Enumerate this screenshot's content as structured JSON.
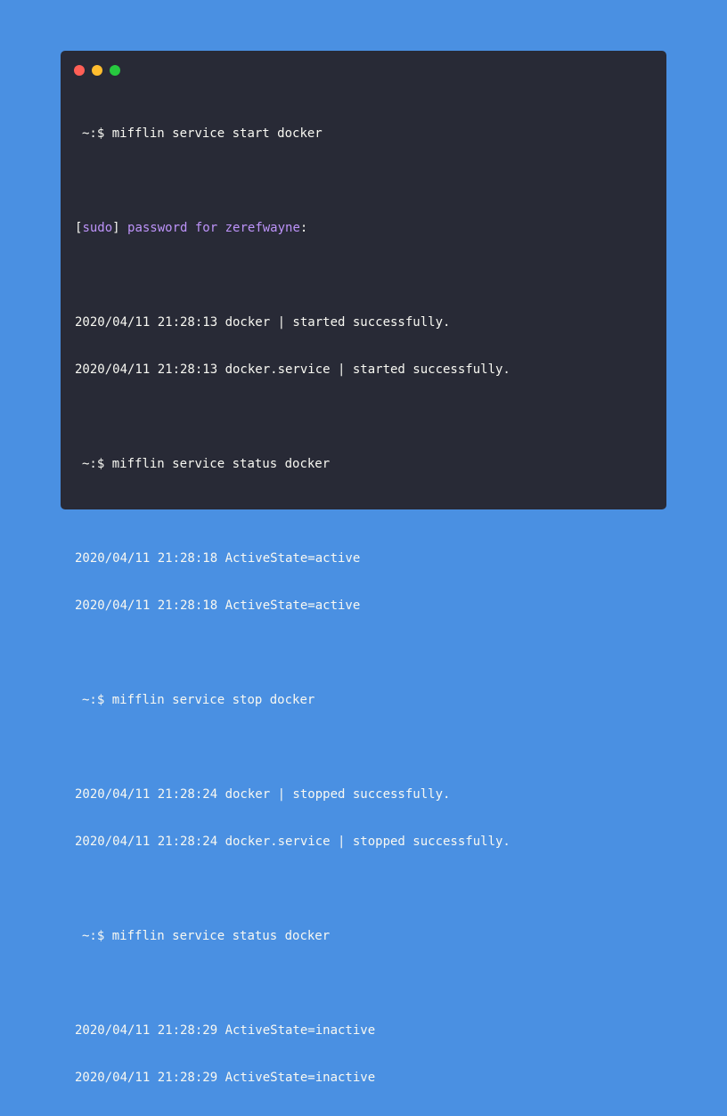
{
  "colors": {
    "background": "#4a90e2",
    "terminal_bg": "#282a36",
    "text": "#f8f8f2",
    "accent": "#bd93f9",
    "close": "#ff5f56",
    "minimize": "#ffbd2e",
    "maximize": "#27c93f"
  },
  "window_controls": {
    "close": "close-control",
    "minimize": "minimize-control",
    "maximize": "maximize-control"
  },
  "terminal": {
    "prompt_symbol": "~:$",
    "cmd1": "mifflin service start docker",
    "sudo_open": "[",
    "sudo_word": "sudo",
    "sudo_close": "]",
    "sudo_text": " password for ",
    "sudo_user": "zerefwayne",
    "sudo_colon": ":",
    "out1": [
      "2020/04/11 21:28:13 docker | started successfully.",
      "2020/04/11 21:28:13 docker.service | started successfully."
    ],
    "cmd2": "mifflin service status docker",
    "out2": [
      "2020/04/11 21:28:18 ActiveState=active",
      "2020/04/11 21:28:18 ActiveState=active"
    ],
    "cmd3": "mifflin service stop docker",
    "out3": [
      "2020/04/11 21:28:24 docker | stopped successfully.",
      "2020/04/11 21:28:24 docker.service | stopped successfully."
    ],
    "cmd4": "mifflin service status docker",
    "out4": [
      "2020/04/11 21:28:29 ActiveState=inactive",
      "2020/04/11 21:28:29 ActiveState=inactive"
    ]
  }
}
